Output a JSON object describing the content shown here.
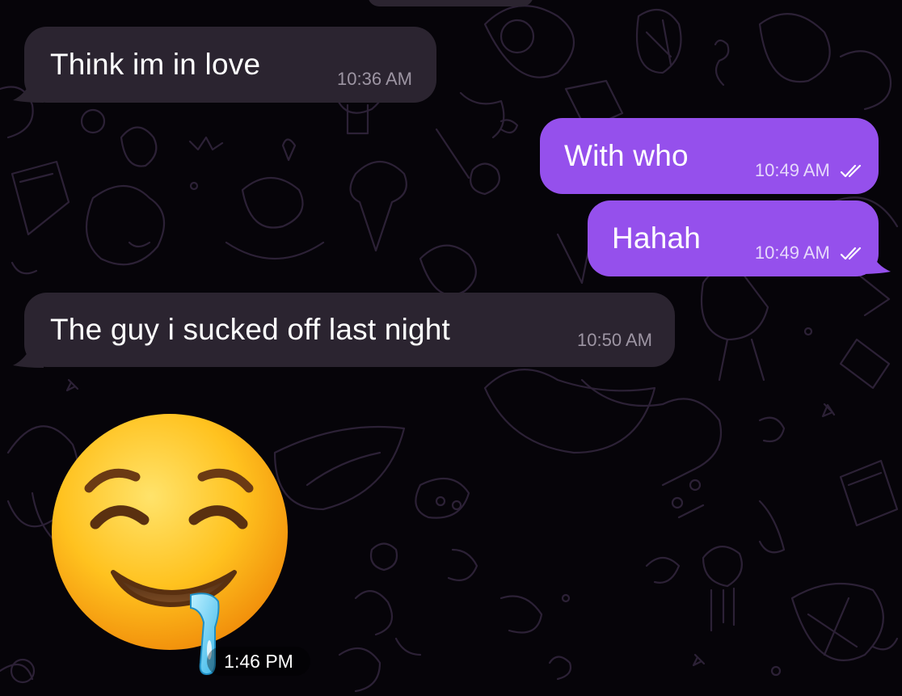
{
  "messages": [
    {
      "text": "Think im in love",
      "time": "10:36 AM",
      "direction": "incoming"
    },
    {
      "text": "With who",
      "time": "10:49 AM",
      "direction": "outgoing",
      "status": "read-double-check"
    },
    {
      "text": "Hahah",
      "time": "10:49 AM",
      "direction": "outgoing",
      "status": "read-double-check"
    },
    {
      "text": "The guy i sucked off last night",
      "time": "10:50 AM",
      "direction": "incoming"
    }
  ],
  "sticker": {
    "emoji": "drooling-face",
    "time": "1:46 PM"
  },
  "colors": {
    "background": "#060409",
    "incoming_bubble": "#2b2430",
    "outgoing_bubble": "#9550ec",
    "doodle_stroke": "#2a1f33"
  }
}
